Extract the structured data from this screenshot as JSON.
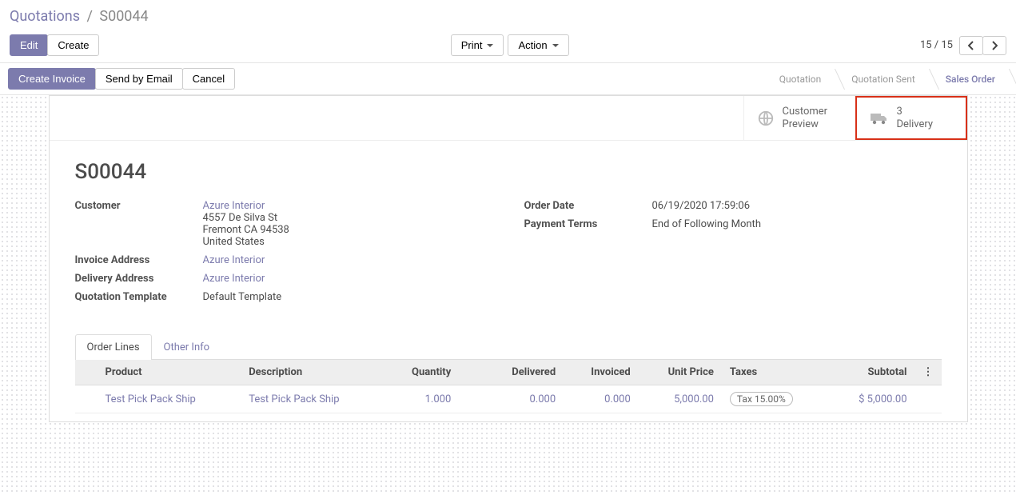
{
  "breadcrumb": {
    "parent": "Quotations",
    "current": "S00044"
  },
  "toolbar": {
    "edit": "Edit",
    "create": "Create",
    "print": "Print",
    "action": "Action",
    "pager": "15 / 15"
  },
  "actions": {
    "create_invoice": "Create Invoice",
    "send_email": "Send by Email",
    "cancel": "Cancel"
  },
  "status": {
    "quotation": "Quotation",
    "quotation_sent": "Quotation Sent",
    "sales_order": "Sales Order"
  },
  "statbtns": {
    "preview_l1": "Customer",
    "preview_l2": "Preview",
    "delivery_n": "3",
    "delivery_label": "Delivery"
  },
  "order": {
    "title": "S00044",
    "labels": {
      "customer": "Customer",
      "invoice_addr": "Invoice Address",
      "delivery_addr": "Delivery Address",
      "quote_template": "Quotation Template",
      "order_date": "Order Date",
      "payment_terms": "Payment Terms"
    },
    "customer_name": "Azure Interior",
    "addr1": "4557 De Silva St",
    "addr2": "Fremont CA 94538",
    "addr3": "United States",
    "invoice_addr": "Azure Interior",
    "delivery_addr": "Azure Interior",
    "quote_template": "Default Template",
    "order_date": "06/19/2020 17:59:06",
    "payment_terms": "End of Following Month"
  },
  "tabs": {
    "order_lines": "Order Lines",
    "other_info": "Other Info"
  },
  "table": {
    "headers": {
      "product": "Product",
      "description": "Description",
      "quantity": "Quantity",
      "delivered": "Delivered",
      "invoiced": "Invoiced",
      "unit_price": "Unit Price",
      "taxes": "Taxes",
      "subtotal": "Subtotal"
    },
    "row": {
      "product": "Test Pick Pack Ship",
      "description": "Test Pick Pack Ship",
      "quantity": "1.000",
      "delivered": "0.000",
      "invoiced": "0.000",
      "unit_price": "5,000.00",
      "taxes": "Tax 15.00%",
      "subtotal": "$ 5,000.00"
    }
  }
}
